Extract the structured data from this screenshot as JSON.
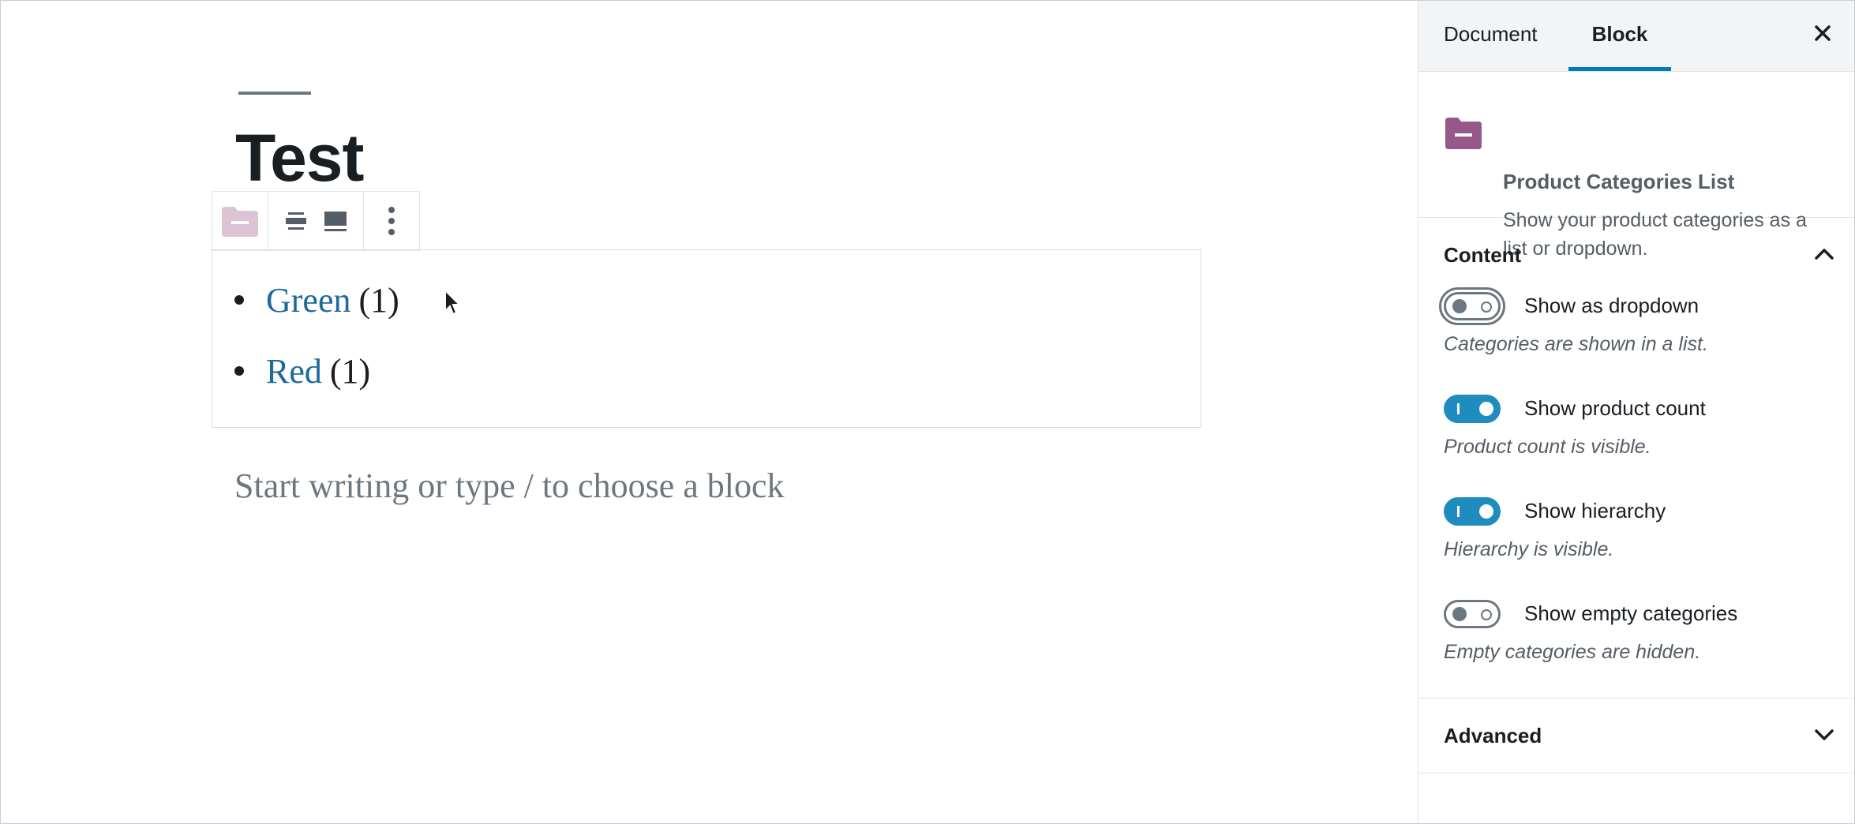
{
  "editor": {
    "post_title": "Test",
    "categories": [
      {
        "name": "Green",
        "count": "(1)"
      },
      {
        "name": "Red",
        "count": "(1)"
      }
    ],
    "placeholder": "Start writing or type / to choose a block"
  },
  "sidebar": {
    "tabs": {
      "document": "Document",
      "block": "Block"
    },
    "block_card": {
      "title": "Product Categories List",
      "description": "Show your product categories as a list or dropdown.",
      "icon": "folder-icon",
      "icon_color": "#96588a"
    },
    "content_panel": {
      "title": "Content",
      "toggles": [
        {
          "label": "Show as dropdown",
          "help": "Categories are shown in a list.",
          "checked": false
        },
        {
          "label": "Show product count",
          "help": "Product count is visible.",
          "checked": true
        },
        {
          "label": "Show hierarchy",
          "help": "Hierarchy is visible.",
          "checked": true
        },
        {
          "label": "Show empty categories",
          "help": "Empty categories are hidden.",
          "checked": false
        }
      ]
    },
    "advanced_panel": {
      "title": "Advanced"
    }
  },
  "colors": {
    "accent": "#007cba",
    "toggle_on": "#1e8cbe",
    "link": "#1e6a9b"
  }
}
